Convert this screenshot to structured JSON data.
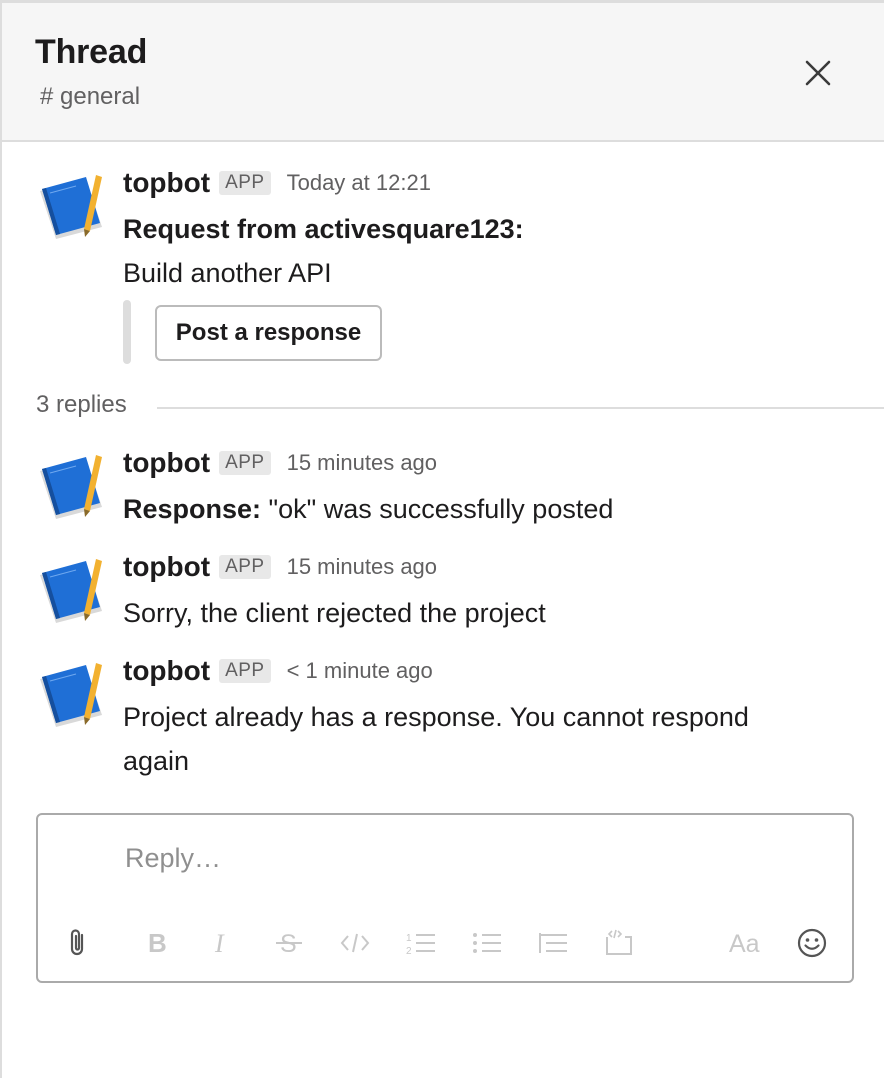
{
  "header": {
    "title": "Thread",
    "channel": "# general"
  },
  "parent": {
    "author": "topbot",
    "badge": "APP",
    "time": "Today at 12:21",
    "line1": "Request from activesquare123:",
    "line2": "Build another API",
    "button_label": "Post a response"
  },
  "replies_label": "3 replies",
  "replies": [
    {
      "author": "topbot",
      "badge": "APP",
      "time": "15 minutes ago",
      "bold_prefix": "Response:",
      "text": " \"ok\" was successfully posted"
    },
    {
      "author": "topbot",
      "badge": "APP",
      "time": "15 minutes ago",
      "text": "Sorry, the client rejected the project"
    },
    {
      "author": "topbot",
      "badge": "APP",
      "time": "< 1 minute ago",
      "text_line1": "Project already has a response. You cannot respond",
      "text_line2": "again"
    }
  ],
  "composer": {
    "placeholder": "Reply…"
  },
  "icons": {
    "close": "close-icon",
    "attach": "paperclip-icon",
    "bold": "bold-icon",
    "italic": "italic-icon",
    "strike": "strikethrough-icon",
    "code": "code-icon",
    "ordered": "ordered-list-icon",
    "bullet": "bullet-list-icon",
    "quote": "quote-icon",
    "codeblock": "code-block-icon",
    "format": "format-toggle-icon",
    "emoji": "emoji-icon"
  },
  "colors": {
    "avatar_blue": "#1f6fd6",
    "avatar_pencil": "#f2b130",
    "muted_text": "#616061",
    "toolbar_inactive": "#c8c8c8"
  }
}
